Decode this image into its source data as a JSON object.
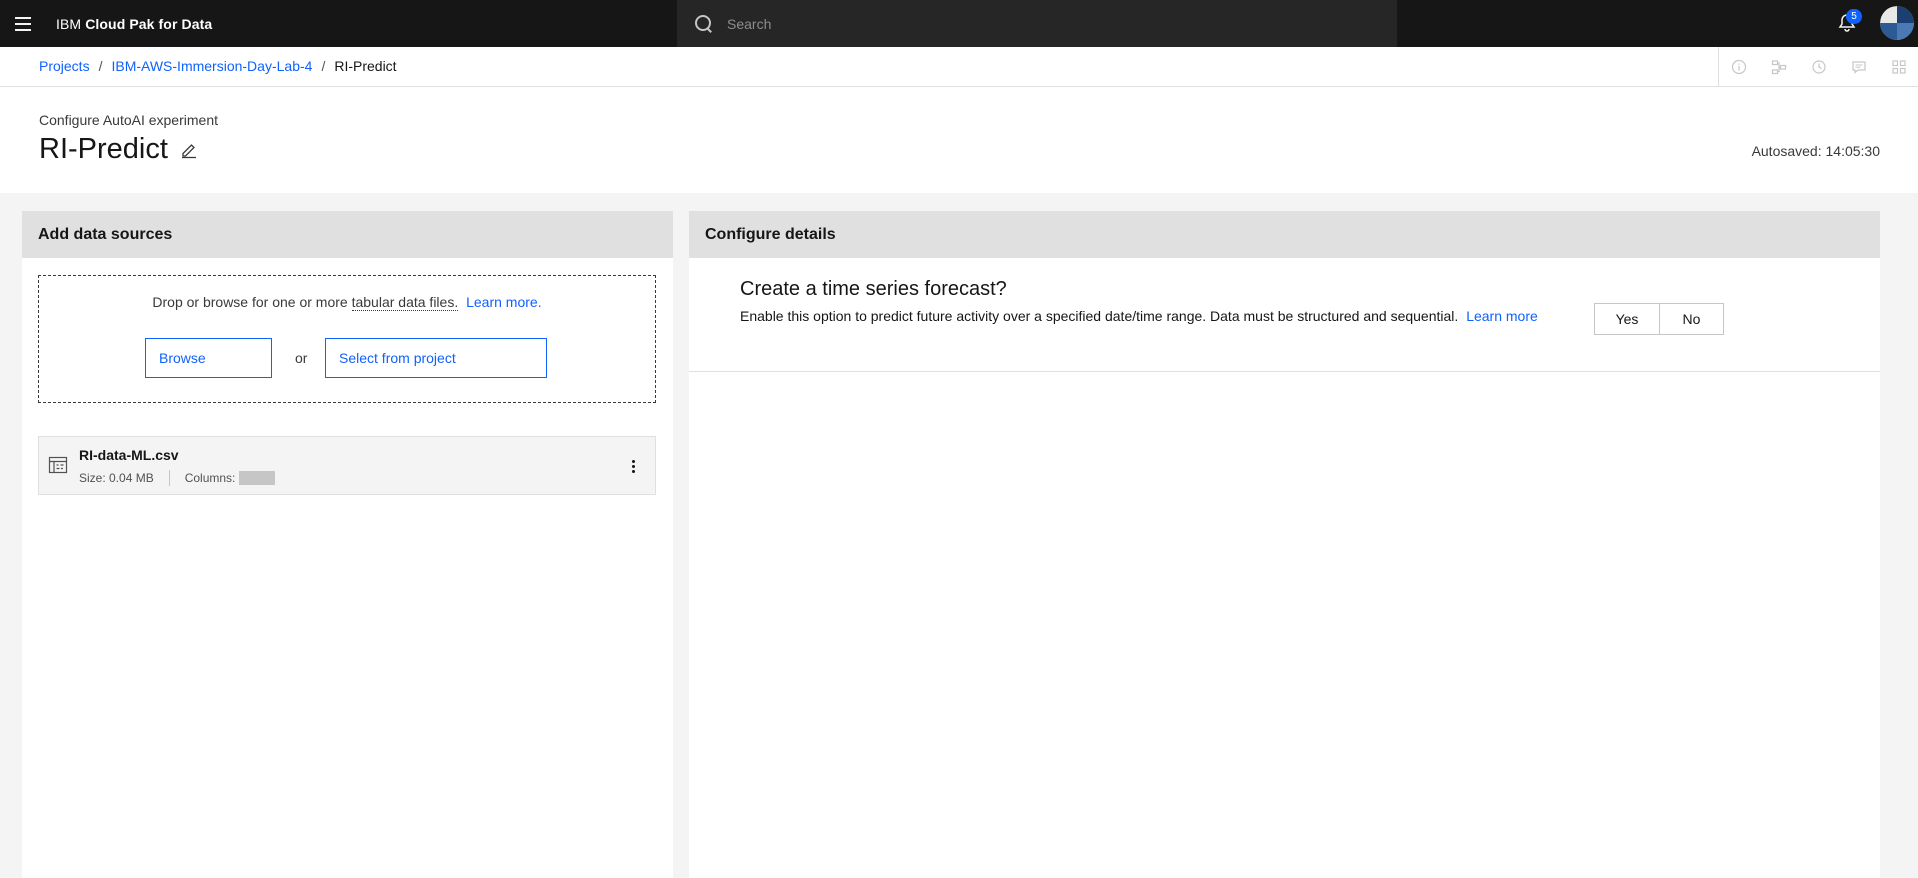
{
  "header": {
    "brand_prefix": "IBM",
    "brand_name": "Cloud Pak for Data",
    "search_placeholder": "Search",
    "notification_count": "5"
  },
  "breadcrumb": {
    "items": [
      "Projects",
      "IBM-AWS-Immersion-Day-Lab-4"
    ],
    "current": "RI-Predict",
    "separator": "/"
  },
  "page": {
    "subtitle": "Configure AutoAI experiment",
    "title": "RI-Predict",
    "autosaved": "Autosaved: 14:05:30"
  },
  "data_sources": {
    "heading": "Add data sources",
    "drop_text": "Drop or browse for one or more",
    "drop_term": "tabular data files.",
    "learn_more": "Learn more.",
    "browse_label": "Browse",
    "or_label": "or",
    "select_label": "Select from project",
    "file": {
      "name": "RI-data-ML.csv",
      "size": "Size: 0.04 MB",
      "columns_label": "Columns:"
    }
  },
  "configure": {
    "heading": "Configure details",
    "ts_title": "Create a time series forecast?",
    "ts_desc": "Enable this option to predict future activity over a specified date/time range. Data must be structured and sequential.",
    "ts_learn_more": "Learn more",
    "yes_label": "Yes",
    "no_label": "No"
  },
  "colors": {
    "accent": "#0f62fe",
    "header_bg": "#161616"
  }
}
